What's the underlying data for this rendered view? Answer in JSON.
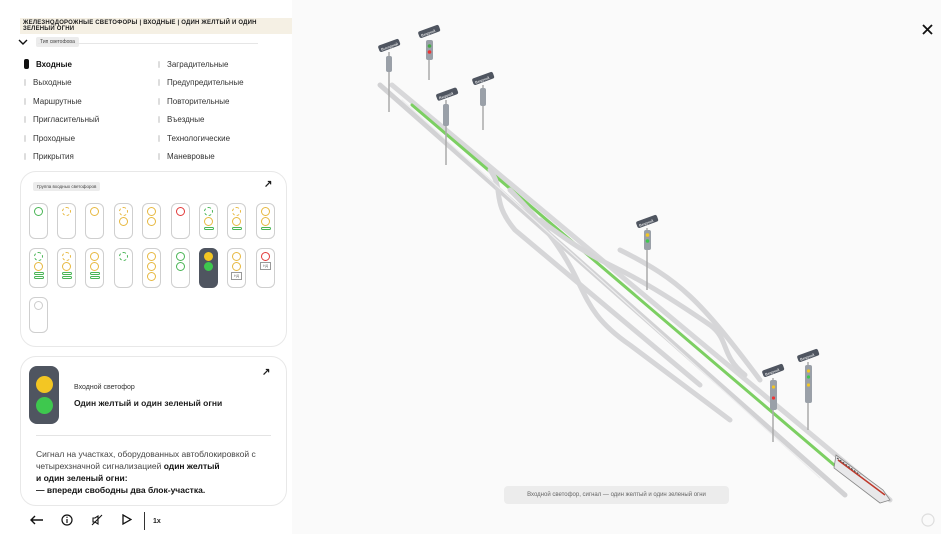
{
  "breadcrumb": "железнодорожные светофоры | входные | один желтый и один зеленый огни",
  "type_tag": "Тип светофора",
  "types_left": [
    "Входные",
    "Выходные",
    "Маршрутные",
    "Пригласительный",
    "Проходные",
    "Прикрытия"
  ],
  "types_right": [
    "Заградительные",
    "Предупредительные",
    "Повторительные",
    "Въездные",
    "Технологические",
    "Маневровые"
  ],
  "group_tag": "Группа входных светофоров",
  "detail": {
    "subtitle": "Входной светофор",
    "title": "Один желтый и один зеленый огни",
    "desc_1": "Сигнал на участках, оборудованных автоблокировкой с четырехзначной сигнализацией",
    "desc_bold_1": "один желтый",
    "desc_bold_2": "и один зеленый огни:",
    "desc_bold_3": "— впереди свободны два блок-участка."
  },
  "caption": "Входной светофор, сигнал — один желтый и один зеленый огни",
  "speed": "1x",
  "scene_labels": [
    "Выходной",
    "Входной",
    "Входной",
    "Входной",
    "Входной",
    "Входной",
    "Входной"
  ],
  "lamp_box_text": "НД",
  "colors": {
    "yellow": "#f3c623",
    "green": "#3ec84e",
    "track_green": "#7ccf62",
    "panel": "#4f5560"
  },
  "icons": [
    "back-arrow-icon",
    "info-icon",
    "sound-off-icon",
    "play-icon",
    "close-icon",
    "expand-arrow-icon",
    "chevron-down-icon"
  ]
}
